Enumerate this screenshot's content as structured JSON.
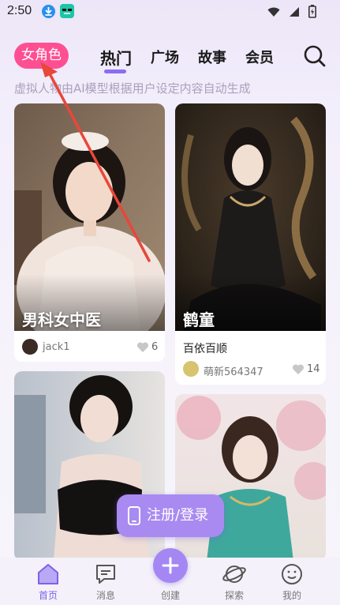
{
  "status_bar": {
    "time": "2:50",
    "icons": [
      "download-icon",
      "app-notification-icon",
      "wifi-icon",
      "signal-icon",
      "battery-icon"
    ]
  },
  "header": {
    "category_pill": "女角色",
    "tabs": [
      {
        "label": "热门",
        "active": true
      },
      {
        "label": "广场",
        "active": false
      },
      {
        "label": "故事",
        "active": false
      },
      {
        "label": "会员",
        "active": false
      }
    ],
    "search_icon": "search-icon",
    "disclaimer": "虚拟人物由AI模型根据用户设定内容自动生成"
  },
  "cards": [
    {
      "title": "男科女中医",
      "username": "jack1",
      "likes": "6"
    },
    {
      "title": "鹤童",
      "subtitle": "百依百顺",
      "username": "萌新564347",
      "likes": "14"
    },
    {
      "title": ""
    },
    {
      "title": ""
    }
  ],
  "register_button": "注册/登录",
  "bottom_nav": [
    {
      "label": "首页",
      "icon": "home-icon",
      "active": true
    },
    {
      "label": "消息",
      "icon": "message-icon",
      "active": false
    },
    {
      "label": "创建",
      "icon": "plus-icon",
      "active": false
    },
    {
      "label": "探索",
      "icon": "planet-icon",
      "active": false
    },
    {
      "label": "我的",
      "icon": "profile-icon",
      "active": false
    }
  ],
  "colors": {
    "accent": "#8b6cf2",
    "pill": "#ff4f93",
    "annotation_arrow": "#e8473a"
  }
}
